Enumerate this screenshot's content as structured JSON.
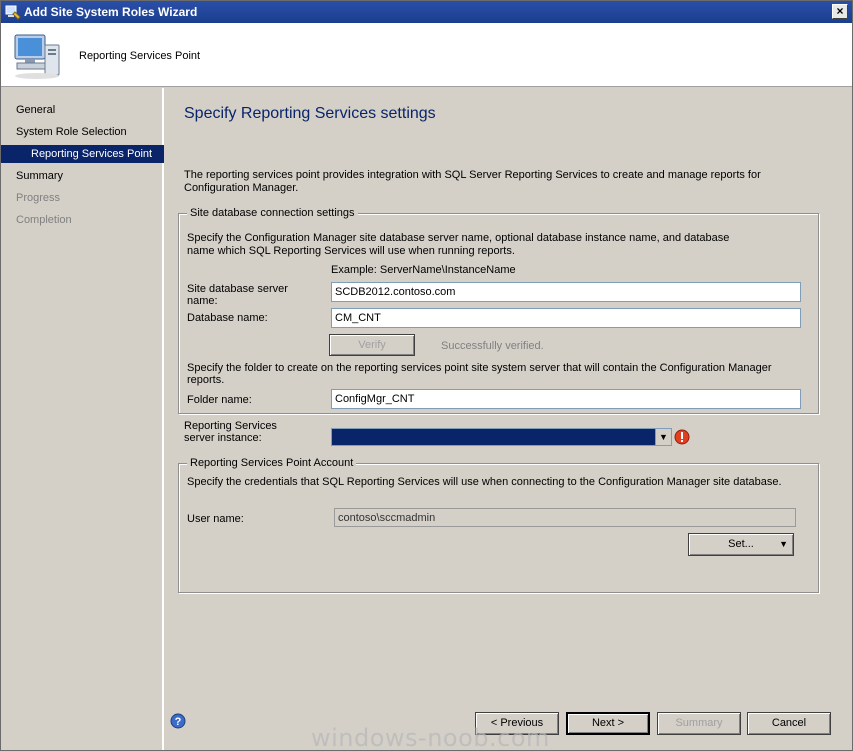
{
  "window": {
    "title": "Add Site System Roles Wizard",
    "close_label": "×"
  },
  "header": {
    "title": "Reporting Services Point"
  },
  "nav": {
    "items": [
      {
        "label": "General"
      },
      {
        "label": "System Role Selection"
      },
      {
        "label": "Reporting Services Point"
      },
      {
        "label": "Summary"
      },
      {
        "label": "Progress"
      },
      {
        "label": "Completion"
      }
    ]
  },
  "main": {
    "title": "Specify Reporting Services settings",
    "intro": "The reporting services point provides integration with SQL Server Reporting Services to create and manage reports for Configuration Manager.",
    "db_group": {
      "legend": "Site database connection settings",
      "description": "Specify the Configuration Manager site database server name, optional database instance name, and database name which SQL Reporting Services will use when running reports.",
      "example": "Example: ServerName\\InstanceName",
      "server_label": "Site database server name:",
      "server_value": "SCDB2012.contoso.com",
      "dbname_label": "Database name:",
      "dbname_value": "CM_CNT",
      "verify_label": "Verify",
      "verify_status": "Successfully verified.",
      "folder_description": "Specify the folder to create on the reporting services point site system server that will contain the Configuration Manager reports.",
      "folder_label": "Folder name:",
      "folder_value": "ConfigMgr_CNT"
    },
    "instance": {
      "label": "Reporting Services server instance:",
      "value": ""
    },
    "account_group": {
      "legend": "Reporting Services Point Account",
      "description": "Specify the credentials that SQL Reporting Services will use when connecting to the Configuration Manager site database.",
      "user_label": "User name:",
      "user_value": "contoso\\sccmadmin",
      "set_label": "Set...",
      "set_arrow": "▼"
    }
  },
  "footer": {
    "previous_label": "< Previous",
    "next_label": "Next >",
    "summary_label": "Summary",
    "cancel_label": "Cancel"
  },
  "watermark": "windows-noob.com",
  "colors": {
    "accent": "#0a246a",
    "titlebar": "#1b3f8e",
    "background": "#d4d0c8"
  }
}
